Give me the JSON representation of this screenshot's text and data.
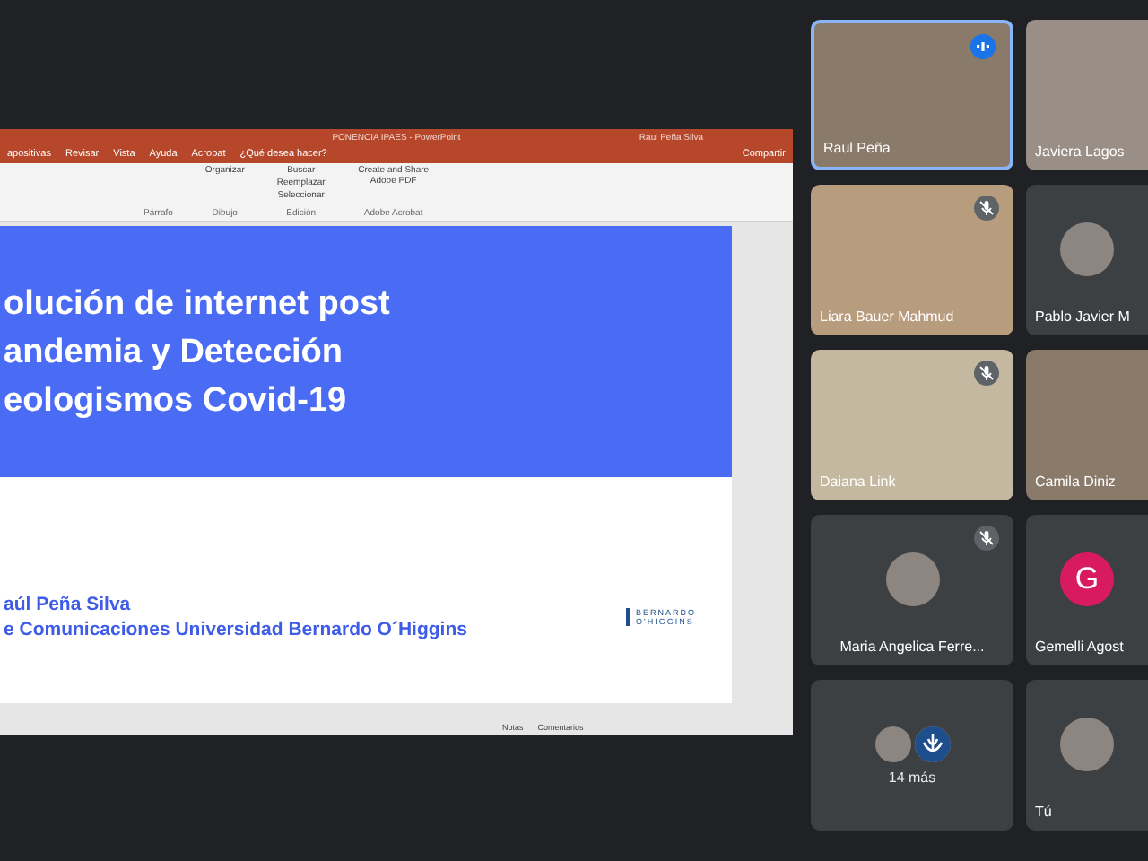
{
  "presentation": {
    "title": "PONENCIA IPAES - PowerPoint",
    "user": "Raul Peña Silva",
    "menu": [
      "apositivas",
      "Revisar",
      "Vista",
      "Ayuda",
      "Acrobat",
      "¿Qué desea hacer?"
    ],
    "share": "Compartir",
    "ribbon": {
      "groups": [
        {
          "label": "Párrafo"
        },
        {
          "label": "Dibujo",
          "buttons": [
            "Organizar"
          ]
        },
        {
          "label": "Edición",
          "buttons": [
            "Buscar",
            "Reemplazar",
            "Seleccionar"
          ]
        },
        {
          "label": "Adobe Acrobat",
          "buttons": [
            "Create and Share Adobe PDF"
          ]
        }
      ]
    },
    "slide": {
      "title_lines": [
        "olución de internet post",
        "andemia y Detección",
        "eologismos Covid-19"
      ],
      "subtitle_lines": [
        "aúl Peña Silva",
        "e Comunicaciones Universidad Bernardo O´Higgins"
      ],
      "logo": [
        "BERNARDO",
        "O'HIGGINS"
      ]
    },
    "status_bar": [
      "Notas",
      "Comentarios"
    ]
  },
  "participants": [
    {
      "name": "Raul Peña",
      "kind": "video",
      "speaking": true,
      "muted": false
    },
    {
      "name": "Javiera Lagos",
      "kind": "video",
      "speaking": false,
      "muted": false
    },
    {
      "name": "Liara Bauer Mahmud",
      "kind": "video",
      "speaking": false,
      "muted": true
    },
    {
      "name": "Pablo Javier M",
      "kind": "avatar",
      "speaking": false,
      "muted": false
    },
    {
      "name": "Daiana Link",
      "kind": "video",
      "speaking": false,
      "muted": true
    },
    {
      "name": "Camila Diniz",
      "kind": "video",
      "speaking": false,
      "muted": false
    },
    {
      "name": "Maria Angelica Ferre...",
      "kind": "avatar",
      "speaking": false,
      "muted": true
    },
    {
      "name": "Gemelli Agost",
      "kind": "letter",
      "initial": "G",
      "speaking": false,
      "muted": false
    },
    {
      "name": "14 más",
      "kind": "overflow",
      "speaking": false,
      "muted": false
    },
    {
      "name": "Tú",
      "kind": "avatar",
      "speaking": false,
      "muted": false
    }
  ]
}
